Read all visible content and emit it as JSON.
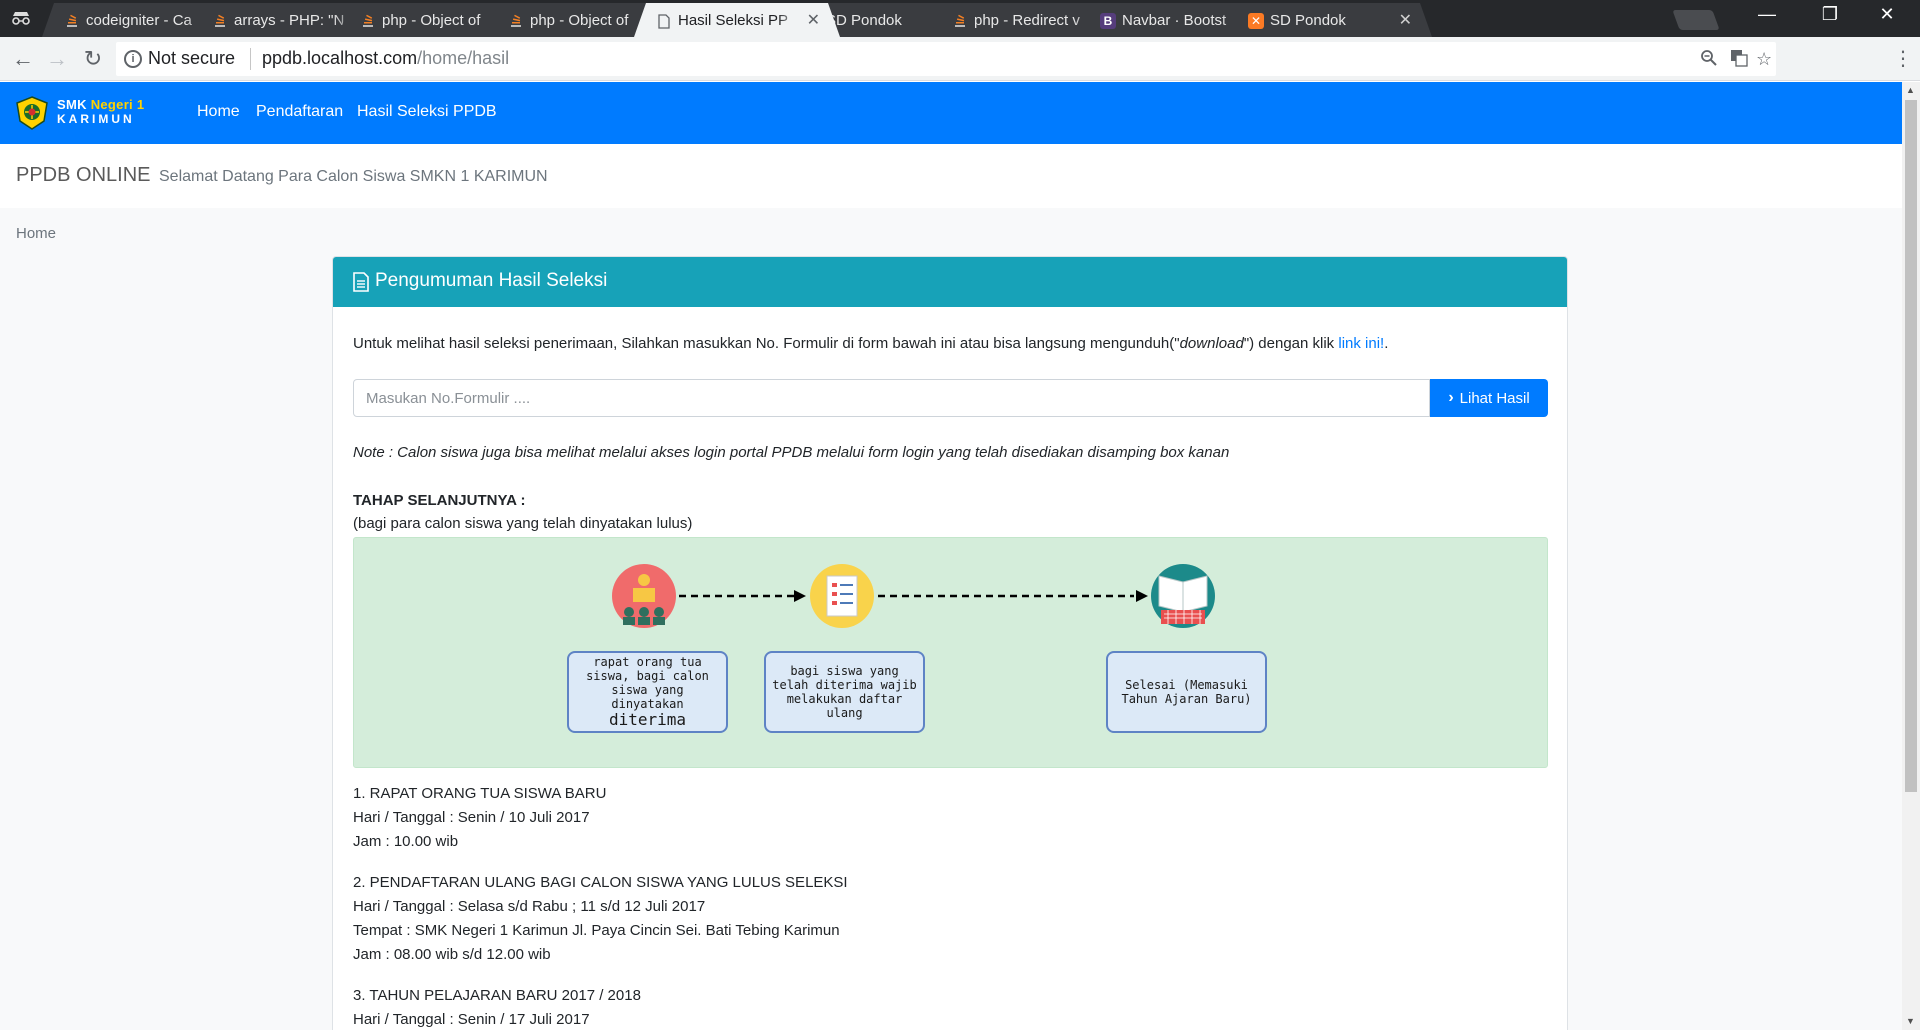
{
  "browser": {
    "tabs": [
      {
        "title": "codeigniter - Ca",
        "favicon": "stackoverflow-icon",
        "active": false
      },
      {
        "title": "arrays - PHP: \"N",
        "favicon": "stackoverflow-icon",
        "active": false
      },
      {
        "title": "php - Object of",
        "favicon": "stackoverflow-icon",
        "active": false
      },
      {
        "title": "php - Object of",
        "favicon": "stackoverflow-icon",
        "active": false
      },
      {
        "title": "Hasil Seleksi PP",
        "favicon": "document-icon",
        "active": true
      },
      {
        "title": "SD Pondok",
        "favicon": "xampp-icon",
        "active": false
      },
      {
        "title": "php - Redirect v",
        "favicon": "stackoverflow-icon",
        "active": false
      },
      {
        "title": "Navbar · Bootst",
        "favicon": "bootstrap-icon",
        "active": false
      },
      {
        "title": "SD Pondok",
        "favicon": "xampp-icon",
        "active": false
      }
    ],
    "security_label": "Not secure",
    "url_host": "ppdb.localhost.com",
    "url_path": "/home/hasil"
  },
  "site": {
    "logo_line1_a": "SMK ",
    "logo_line1_b": "Negeri 1",
    "logo_line2": "KARIMUN",
    "nav": [
      "Home",
      "Pendaftaran",
      "Hasil Seleksi PPDB"
    ],
    "banner_title": "PPDB ONLINE",
    "banner_subtitle": "Selamat Datang Para Calon Siswa SMKN 1 KARIMUN",
    "breadcrumb": "Home"
  },
  "card": {
    "title": "Pengumuman Hasil Seleksi",
    "intro_before": "Untuk melihat hasil seleksi penerimaan, Silahkan masukkan No. Formulir di form bawah ini atau bisa langsung mengunduh(\"",
    "intro_italic": "download",
    "intro_after": "\") dengan klik ",
    "intro_link": "link ini!",
    "intro_end": ".",
    "input_placeholder": "Masukan No.Formulir ....",
    "button_label": "Lihat Hasil",
    "note": "Note : Calon siswa juga bisa melihat melalui akses login portal PPDB melalui form login yang telah disediakan disamping box kanan",
    "tahap_heading": "TAHAP SELANJUTNYA :",
    "tahap_sub": "(bagi para calon siswa yang telah dinyatakan lulus)",
    "steps": [
      {
        "text": "rapat orang tua siswa, bagi calon siswa yang dinyatakan",
        "emph": "diterima"
      },
      {
        "text": "bagi siswa yang telah diterima wajib melakukan daftar ulang",
        "emph": ""
      },
      {
        "text": "Selesai (Memasuki Tahun Ajaran Baru)",
        "emph": ""
      }
    ],
    "info_blocks": [
      [
        "1. RAPAT ORANG TUA SISWA BARU",
        "Hari / Tanggal : Senin / 10 Juli 2017",
        "Jam : 10.00 wib"
      ],
      [
        "2. PENDAFTARAN ULANG BAGI CALON SISWA YANG LULUS SELEKSI",
        "Hari / Tanggal : Selasa s/d Rabu ; 11 s/d 12 Juli 2017",
        "Tempat : SMK Negeri 1 Karimun Jl. Paya Cincin Sei. Bati Tebing Karimun",
        "Jam : 08.00 wib s/d 12.00 wib"
      ],
      [
        "3. TAHUN PELAJARAN BARU 2017 / 2018",
        "Hari / Tanggal : Senin / 17 Juli 2017"
      ]
    ]
  },
  "colors": {
    "navbar": "#007bff",
    "card_header": "#17a2b8",
    "diagram_bg": "#d4edda",
    "step_border": "#5e83c5"
  }
}
